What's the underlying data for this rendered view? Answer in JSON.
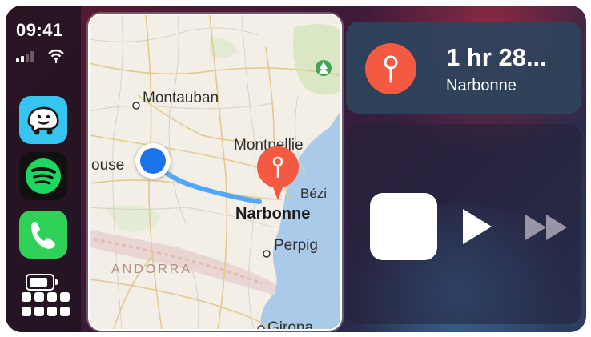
{
  "status": {
    "time": "09:41"
  },
  "dock": {
    "apps": [
      "Waze",
      "Spotify",
      "Phone"
    ]
  },
  "map": {
    "labels": [
      "Montauban",
      "Montpellie",
      "ouse",
      "Bézi",
      "Narbonne",
      "Perpig",
      "ANDORRA",
      "Girona"
    ]
  },
  "navigation": {
    "eta": "1 hr 28...",
    "destination": "Narbonne"
  },
  "colors": {
    "pin": "#f45a41",
    "route": "#4aa3ff",
    "location": "#1a73e8"
  },
  "icons": [
    "signal-icon",
    "wifi-icon",
    "waze-icon",
    "spotify-icon",
    "phone-icon",
    "battery-icon",
    "app-grid-icon",
    "destination-pin-icon",
    "music-app-icon",
    "play-icon",
    "fast-forward-icon"
  ]
}
